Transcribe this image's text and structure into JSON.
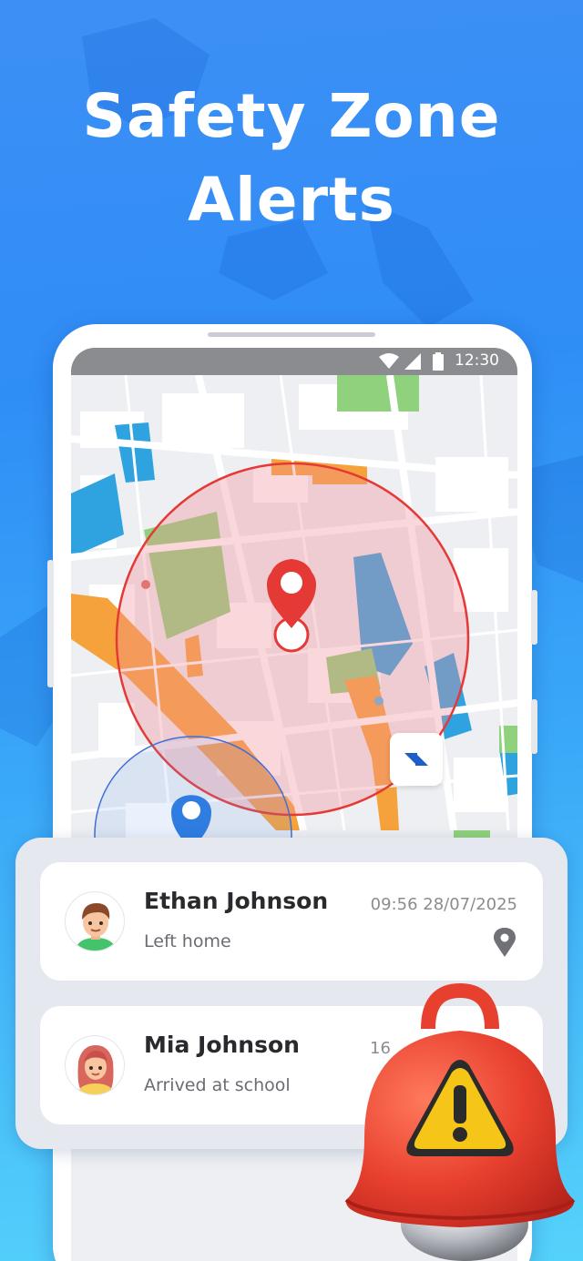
{
  "headline": {
    "line1": "Safety Zone",
    "line2": "Alerts"
  },
  "status_bar": {
    "time": "12:30",
    "icons": [
      "wifi-icon",
      "signal-icon",
      "battery-icon"
    ]
  },
  "map": {
    "safe_zone_color": "#e53935",
    "secondary_zone_color": "#3f6fd8",
    "marker_colors": {
      "primary": "#e53935",
      "secondary": "#2f7de1"
    }
  },
  "alerts": [
    {
      "name": "Ethan Johnson",
      "status": "Left home",
      "time": "09:56 28/07/2025",
      "avatar": "boy-avatar",
      "icon": "location-pin-icon"
    },
    {
      "name": "Mia Johnson",
      "status": "Arrived at school",
      "time": "16",
      "avatar": "girl-avatar"
    }
  ],
  "colors": {
    "background_top": "#3d8ff5",
    "background_bottom": "#55d2fb",
    "bell": "#e8402f",
    "warning": "#f5c518"
  }
}
